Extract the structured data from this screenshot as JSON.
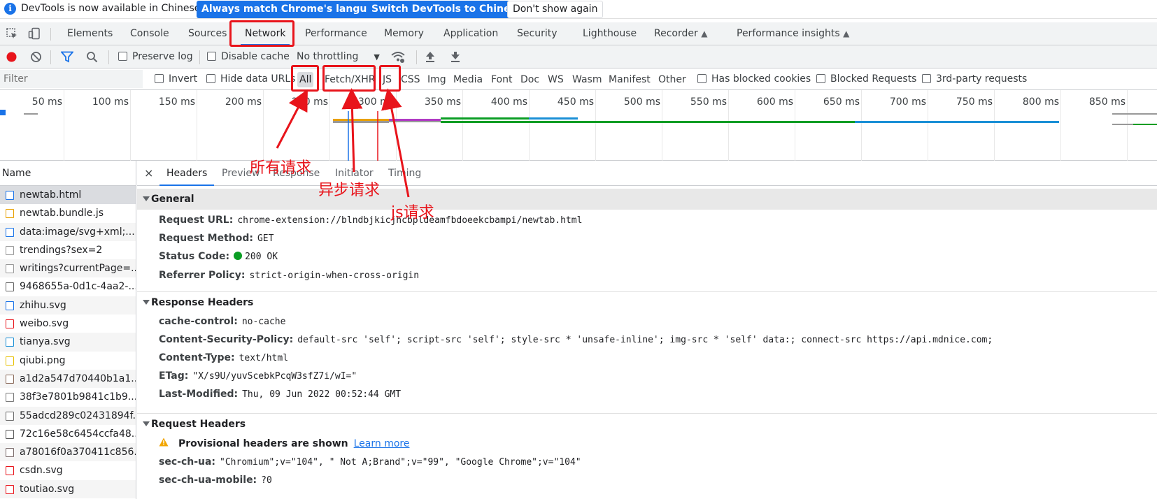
{
  "infobar": {
    "message": "DevTools is now available in Chinese!",
    "match_button": "Always match Chrome's language",
    "switch_button": "Switch DevTools to Chinese",
    "dismiss_button": "Don't show again"
  },
  "tabs": [
    {
      "label": "Elements"
    },
    {
      "label": "Console"
    },
    {
      "label": "Sources"
    },
    {
      "label": "Network"
    },
    {
      "label": "Performance"
    },
    {
      "label": "Memory"
    },
    {
      "label": "Application"
    },
    {
      "label": "Security"
    },
    {
      "label": "Lighthouse"
    },
    {
      "label": "Recorder"
    },
    {
      "label": "Performance insights"
    }
  ],
  "toolbar": {
    "preserve_log": "Preserve log",
    "disable_cache": "Disable cache",
    "throttling": "No throttling"
  },
  "filterbar": {
    "placeholder": "Filter",
    "invert": "Invert",
    "hide_data_urls": "Hide data URLs",
    "types": [
      "All",
      "Fetch/XHR",
      "JS",
      "CSS",
      "Img",
      "Media",
      "Font",
      "Doc",
      "WS",
      "Wasm",
      "Manifest",
      "Other"
    ],
    "has_blocked_cookies": "Has blocked cookies",
    "blocked_requests": "Blocked Requests",
    "third_party": "3rd-party requests"
  },
  "overview": {
    "ticks": [
      "50 ms",
      "100 ms",
      "150 ms",
      "200 ms",
      "250 ms",
      "300 ms",
      "350 ms",
      "400 ms",
      "450 ms",
      "500 ms",
      "550 ms",
      "600 ms",
      "650 ms",
      "700 ms",
      "750 ms",
      "800 ms",
      "850 ms"
    ]
  },
  "requests": {
    "column": "Name",
    "items": [
      {
        "name": "newtab.html"
      },
      {
        "name": "newtab.bundle.js"
      },
      {
        "name": "data:image/svg+xml;..."
      },
      {
        "name": "trendings?sex=2"
      },
      {
        "name": "writings?currentPage=..."
      },
      {
        "name": "9468655a-0d1c-4aa2-..."
      },
      {
        "name": "zhihu.svg"
      },
      {
        "name": "weibo.svg"
      },
      {
        "name": "tianya.svg"
      },
      {
        "name": "qiubi.png"
      },
      {
        "name": "a1d2a547d70440b1a1..."
      },
      {
        "name": "38f3e7801b9841c1b9..."
      },
      {
        "name": "55adcd289c02431894f..."
      },
      {
        "name": "72c16e58c6454ccfa48..."
      },
      {
        "name": "a78016f0a370411c856..."
      },
      {
        "name": "csdn.svg"
      },
      {
        "name": "toutiao.svg"
      }
    ]
  },
  "detail": {
    "close": "×",
    "tabs": [
      "Headers",
      "Preview",
      "Response",
      "Initiator",
      "Timing"
    ],
    "general": {
      "title": "General",
      "rows": [
        {
          "k": "Request URL:",
          "v": "chrome-extension://blndbjkicjhcbpldeamfbdoeekcbampi/newtab.html"
        },
        {
          "k": "Request Method:",
          "v": "GET"
        },
        {
          "k": "Status Code:",
          "v": "200 OK"
        },
        {
          "k": "Referrer Policy:",
          "v": "strict-origin-when-cross-origin"
        }
      ]
    },
    "response": {
      "title": "Response Headers",
      "rows": [
        {
          "k": "cache-control:",
          "v": "no-cache"
        },
        {
          "k": "Content-Security-Policy:",
          "v": "default-src 'self'; script-src 'self'; style-src * 'unsafe-inline'; img-src * 'self' data:; connect-src https://api.mdnice.com;"
        },
        {
          "k": "Content-Type:",
          "v": "text/html"
        },
        {
          "k": "ETag:",
          "v": "\"X/s9U/yuvScebkPcqW3sfZ7i/wI=\""
        },
        {
          "k": "Last-Modified:",
          "v": "Thu, 09 Jun 2022 00:52:44 GMT"
        }
      ]
    },
    "request": {
      "title": "Request Headers",
      "provisional": "Provisional headers are shown",
      "learn_more": "Learn more",
      "rows": [
        {
          "k": "sec-ch-ua:",
          "v": "\"Chromium\";v=\"104\", \" Not A;Brand\";v=\"99\", \"Google Chrome\";v=\"104\""
        },
        {
          "k": "sec-ch-ua-mobile:",
          "v": "?0"
        }
      ]
    }
  },
  "annotations": {
    "all_requests": "所有请求",
    "async_requests": "异步请求",
    "js_requests": "js请求"
  },
  "colors": {
    "accent": "#1a73e8",
    "annotation": "#e8141b",
    "status_ok": "#0a9d24"
  }
}
